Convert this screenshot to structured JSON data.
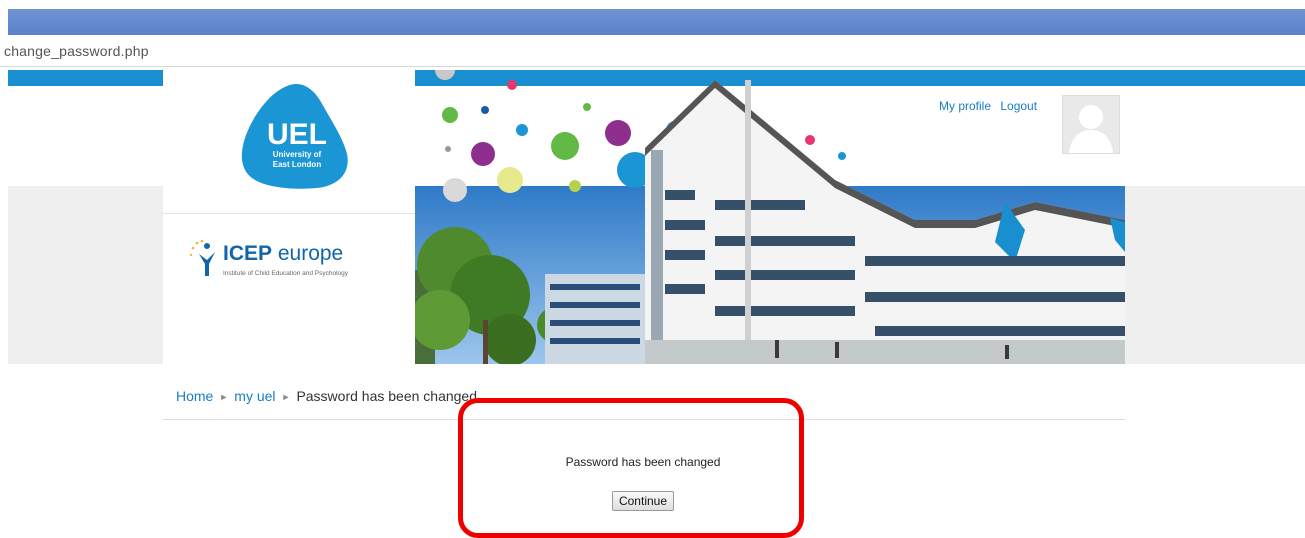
{
  "browser": {
    "url": "change_password.php"
  },
  "header": {
    "uel_logo": {
      "line1": "UEL",
      "line2": "University of",
      "line3": "East London"
    },
    "icep_logo": {
      "name_bold": "ICEP",
      "name_rest": " europe",
      "tagline": "Institute of Child Education and Psychology"
    },
    "user_nav": {
      "profile": "My profile",
      "logout": "Logout"
    }
  },
  "breadcrumb": {
    "items": [
      "Home",
      "my uel",
      "Password has been changed"
    ],
    "separator": "►"
  },
  "main": {
    "message": "Password has been changed",
    "continue_label": "Continue"
  },
  "colors": {
    "accent_blue": "#1a8fcf",
    "link_blue": "#1a7dc5",
    "highlight_red": "#ee0000"
  }
}
